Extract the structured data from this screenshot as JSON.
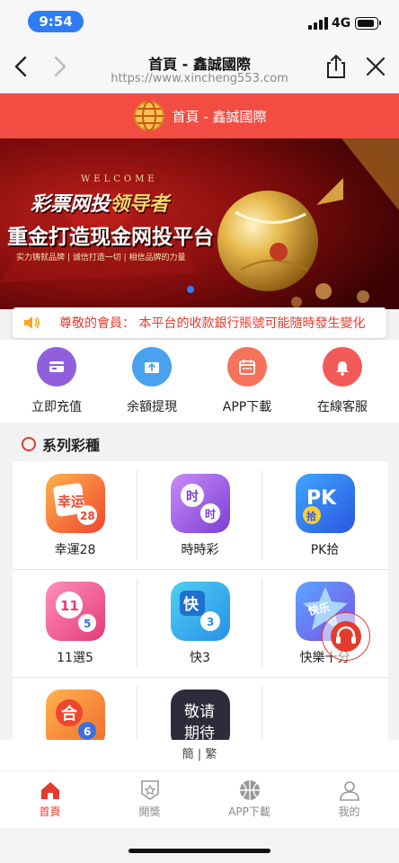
{
  "status_bar": {
    "time": "9:54",
    "network": "4G",
    "battery_level": 0.9
  },
  "browser": {
    "page_title": "首頁 - 鑫誠國際",
    "url": "https://www.xincheng553.com"
  },
  "site_header": {
    "title": "首頁 - 鑫誠國際"
  },
  "banner": {
    "welcome": "WELCOME",
    "slogan_white": "彩票网投",
    "slogan_gold": "领导者",
    "headline": "重金打造现金网投平台",
    "subline": "实力铸就品牌 | 诚信打造一切 | 相信品牌的力量",
    "slide_count": 1,
    "active_slide": 1
  },
  "notice": {
    "text": "尊敬的會員： 本平台的收款銀行賬號可能隨時發生變化"
  },
  "quick_actions": [
    {
      "label": "立即充值",
      "icon": "card-icon",
      "color": "#8f5fdc"
    },
    {
      "label": "余額提現",
      "icon": "withdraw-icon",
      "color": "#4aa1f0"
    },
    {
      "label": "APP下載",
      "icon": "calendar-icon",
      "color": "#f5735b"
    },
    {
      "label": "在線客服",
      "icon": "bell-icon",
      "color": "#f25a5a"
    }
  ],
  "section": {
    "title": "系列彩種"
  },
  "games": [
    {
      "label": "幸運28",
      "icon": "lucky28-icon",
      "badge": "幸运",
      "num": "28"
    },
    {
      "label": "時時彩",
      "icon": "ssc-icon",
      "badge": "时",
      "num": "时"
    },
    {
      "label": "PK拾",
      "icon": "pk10-icon",
      "badge": "PK",
      "num": "拾"
    },
    {
      "label": "11選5",
      "icon": "11x5-icon",
      "badge": "11",
      "num": "5"
    },
    {
      "label": "快3",
      "icon": "k3-icon",
      "badge": "快",
      "num": "3"
    },
    {
      "label": "快樂十分",
      "icon": "happy10-icon",
      "badge": "快乐",
      "num": ""
    },
    {
      "label": "",
      "icon": "he-icon",
      "badge": "合",
      "num": "6"
    },
    {
      "label": "",
      "icon": "coming-soon-icon",
      "badge": "敬请期待",
      "num": ""
    }
  ],
  "language_switch": {
    "simplified": "簡",
    "separator": "|",
    "traditional": "繁"
  },
  "bottom_nav": [
    {
      "label": "首頁",
      "icon": "home-icon",
      "active": true
    },
    {
      "label": "開獎",
      "icon": "award-icon",
      "active": false
    },
    {
      "label": "APP下載",
      "icon": "basketball-icon",
      "active": false
    },
    {
      "label": "我的",
      "icon": "user-icon",
      "active": false
    }
  ],
  "colors": {
    "brand_red": "#f24c43",
    "accent_red": "#e33b2e",
    "ios_blue": "#2e7cf6"
  }
}
